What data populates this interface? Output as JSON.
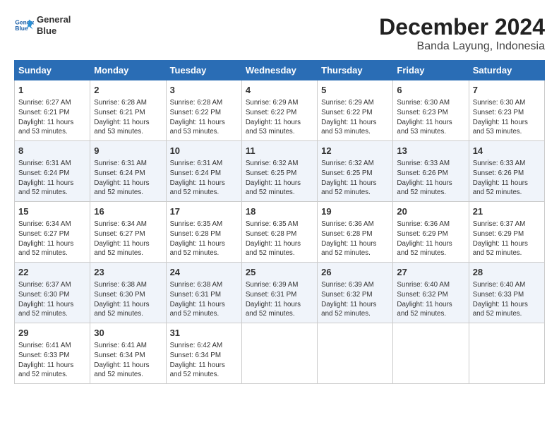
{
  "header": {
    "logo_line1": "General",
    "logo_line2": "Blue",
    "main_title": "December 2024",
    "subtitle": "Banda Layung, Indonesia"
  },
  "columns": [
    "Sunday",
    "Monday",
    "Tuesday",
    "Wednesday",
    "Thursday",
    "Friday",
    "Saturday"
  ],
  "weeks": [
    [
      {
        "day": "1",
        "info": "Sunrise: 6:27 AM\nSunset: 6:21 PM\nDaylight: 11 hours\nand 53 minutes."
      },
      {
        "day": "2",
        "info": "Sunrise: 6:28 AM\nSunset: 6:21 PM\nDaylight: 11 hours\nand 53 minutes."
      },
      {
        "day": "3",
        "info": "Sunrise: 6:28 AM\nSunset: 6:22 PM\nDaylight: 11 hours\nand 53 minutes."
      },
      {
        "day": "4",
        "info": "Sunrise: 6:29 AM\nSunset: 6:22 PM\nDaylight: 11 hours\nand 53 minutes."
      },
      {
        "day": "5",
        "info": "Sunrise: 6:29 AM\nSunset: 6:22 PM\nDaylight: 11 hours\nand 53 minutes."
      },
      {
        "day": "6",
        "info": "Sunrise: 6:30 AM\nSunset: 6:23 PM\nDaylight: 11 hours\nand 53 minutes."
      },
      {
        "day": "7",
        "info": "Sunrise: 6:30 AM\nSunset: 6:23 PM\nDaylight: 11 hours\nand 53 minutes."
      }
    ],
    [
      {
        "day": "8",
        "info": "Sunrise: 6:31 AM\nSunset: 6:24 PM\nDaylight: 11 hours\nand 52 minutes."
      },
      {
        "day": "9",
        "info": "Sunrise: 6:31 AM\nSunset: 6:24 PM\nDaylight: 11 hours\nand 52 minutes."
      },
      {
        "day": "10",
        "info": "Sunrise: 6:31 AM\nSunset: 6:24 PM\nDaylight: 11 hours\nand 52 minutes."
      },
      {
        "day": "11",
        "info": "Sunrise: 6:32 AM\nSunset: 6:25 PM\nDaylight: 11 hours\nand 52 minutes."
      },
      {
        "day": "12",
        "info": "Sunrise: 6:32 AM\nSunset: 6:25 PM\nDaylight: 11 hours\nand 52 minutes."
      },
      {
        "day": "13",
        "info": "Sunrise: 6:33 AM\nSunset: 6:26 PM\nDaylight: 11 hours\nand 52 minutes."
      },
      {
        "day": "14",
        "info": "Sunrise: 6:33 AM\nSunset: 6:26 PM\nDaylight: 11 hours\nand 52 minutes."
      }
    ],
    [
      {
        "day": "15",
        "info": "Sunrise: 6:34 AM\nSunset: 6:27 PM\nDaylight: 11 hours\nand 52 minutes."
      },
      {
        "day": "16",
        "info": "Sunrise: 6:34 AM\nSunset: 6:27 PM\nDaylight: 11 hours\nand 52 minutes."
      },
      {
        "day": "17",
        "info": "Sunrise: 6:35 AM\nSunset: 6:28 PM\nDaylight: 11 hours\nand 52 minutes."
      },
      {
        "day": "18",
        "info": "Sunrise: 6:35 AM\nSunset: 6:28 PM\nDaylight: 11 hours\nand 52 minutes."
      },
      {
        "day": "19",
        "info": "Sunrise: 6:36 AM\nSunset: 6:28 PM\nDaylight: 11 hours\nand 52 minutes."
      },
      {
        "day": "20",
        "info": "Sunrise: 6:36 AM\nSunset: 6:29 PM\nDaylight: 11 hours\nand 52 minutes."
      },
      {
        "day": "21",
        "info": "Sunrise: 6:37 AM\nSunset: 6:29 PM\nDaylight: 11 hours\nand 52 minutes."
      }
    ],
    [
      {
        "day": "22",
        "info": "Sunrise: 6:37 AM\nSunset: 6:30 PM\nDaylight: 11 hours\nand 52 minutes."
      },
      {
        "day": "23",
        "info": "Sunrise: 6:38 AM\nSunset: 6:30 PM\nDaylight: 11 hours\nand 52 minutes."
      },
      {
        "day": "24",
        "info": "Sunrise: 6:38 AM\nSunset: 6:31 PM\nDaylight: 11 hours\nand 52 minutes."
      },
      {
        "day": "25",
        "info": "Sunrise: 6:39 AM\nSunset: 6:31 PM\nDaylight: 11 hours\nand 52 minutes."
      },
      {
        "day": "26",
        "info": "Sunrise: 6:39 AM\nSunset: 6:32 PM\nDaylight: 11 hours\nand 52 minutes."
      },
      {
        "day": "27",
        "info": "Sunrise: 6:40 AM\nSunset: 6:32 PM\nDaylight: 11 hours\nand 52 minutes."
      },
      {
        "day": "28",
        "info": "Sunrise: 6:40 AM\nSunset: 6:33 PM\nDaylight: 11 hours\nand 52 minutes."
      }
    ],
    [
      {
        "day": "29",
        "info": "Sunrise: 6:41 AM\nSunset: 6:33 PM\nDaylight: 11 hours\nand 52 minutes."
      },
      {
        "day": "30",
        "info": "Sunrise: 6:41 AM\nSunset: 6:34 PM\nDaylight: 11 hours\nand 52 minutes."
      },
      {
        "day": "31",
        "info": "Sunrise: 6:42 AM\nSunset: 6:34 PM\nDaylight: 11 hours\nand 52 minutes."
      },
      {
        "day": "",
        "info": ""
      },
      {
        "day": "",
        "info": ""
      },
      {
        "day": "",
        "info": ""
      },
      {
        "day": "",
        "info": ""
      }
    ]
  ]
}
